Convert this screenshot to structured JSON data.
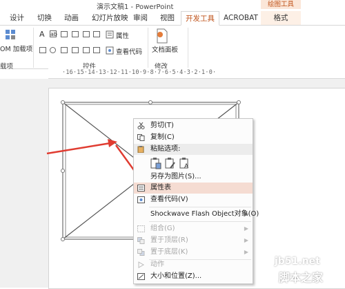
{
  "window": {
    "title": "演示文稿1 - PowerPoint",
    "context_tab_group": "绘图工具"
  },
  "tabs": [
    {
      "label": "设计"
    },
    {
      "label": "切换"
    },
    {
      "label": "动画"
    },
    {
      "label": "幻灯片放映"
    },
    {
      "label": "审阅"
    },
    {
      "label": "视图"
    },
    {
      "label": "开发工具",
      "active": true
    },
    {
      "label": "ACROBAT"
    },
    {
      "label": "格式"
    }
  ],
  "ribbon": {
    "addins_button": "OM 加载项",
    "addins_group": "载项",
    "controls_group": "控件",
    "properties_button": "属性",
    "view_code_button": "查看代码",
    "doc_panel_button": "文档面板",
    "modify_group": "修改"
  },
  "ruler": {
    "text": "·16·15·14·13·12·11·10·9·8·7·6·5·4·3·2·1·0·"
  },
  "context_menu": {
    "items": [
      {
        "label": "剪切(T)",
        "icon": "scissors-icon"
      },
      {
        "label": "复制(C)",
        "icon": "copy-icon"
      },
      {
        "label": "粘贴选项:",
        "icon": "paste-icon"
      },
      {
        "label": "另存为图片(S)..."
      },
      {
        "label": "属性表",
        "icon": "properties-icon"
      },
      {
        "label": "查看代码(V)",
        "icon": "view-code-icon"
      },
      {
        "label": "Shockwave Flash Object对象(O)"
      },
      {
        "label": "组合(G)"
      },
      {
        "label": "置于顶层(R)"
      },
      {
        "label": "置于底层(K)"
      },
      {
        "label": "动作"
      },
      {
        "label": "大小和位置(Z)..."
      }
    ]
  },
  "watermark": {
    "site": "jb51.net",
    "brand": "脚本之家"
  },
  "colors": {
    "accent": "#c0541c",
    "arrow_red": "#e03c31",
    "highlight": "#f5dcd2"
  }
}
